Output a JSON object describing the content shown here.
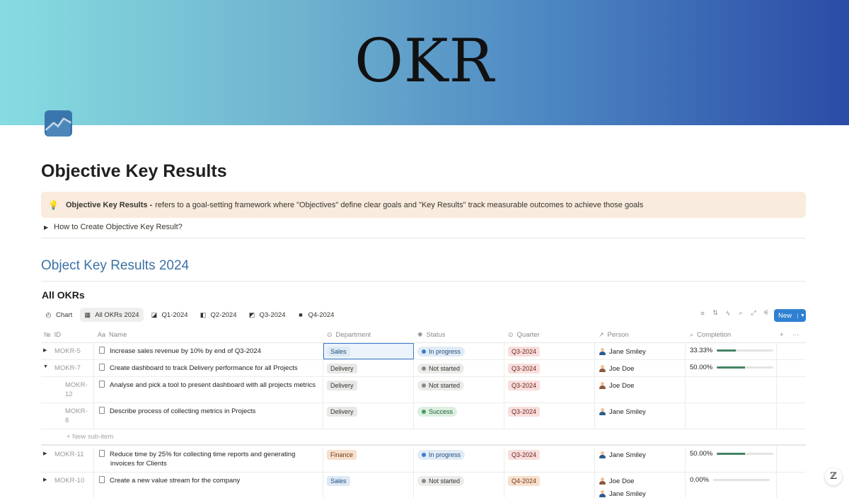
{
  "cover": {
    "title": "OKR"
  },
  "page": {
    "title": "Objective Key Results"
  },
  "callout": {
    "icon": "💡",
    "bold": "Objective Key Results -",
    "text": "refers to a goal-setting framework where \"Objectives\" define clear goals and \"Key Results\" track measurable outcomes to achieve those goals"
  },
  "toggle": {
    "label": "How to Create Objective Key Result?"
  },
  "section": {
    "heading": "Object Key Results 2024"
  },
  "database": {
    "title": "All OKRs",
    "views": [
      {
        "label": "Chart",
        "icon": "◴"
      },
      {
        "label": "All OKRs 2024",
        "icon": "▦"
      },
      {
        "label": "Q1-2024",
        "icon": "◪"
      },
      {
        "label": "Q2-2024",
        "icon": "◧"
      },
      {
        "label": "Q3-2024",
        "icon": "◩"
      },
      {
        "label": "Q4-2024",
        "icon": "■"
      }
    ],
    "new_label": "New",
    "columns": {
      "id": "ID",
      "id_icon": "№",
      "name": "Name",
      "name_icon": "Aa",
      "department": "Department",
      "status": "Status",
      "quarter": "Quarter",
      "person": "Person",
      "completion": "Completion"
    },
    "new_sub_item": "+ New sub-item",
    "rows": [
      {
        "id": "MOKR-5",
        "name": "Increase sales revenue by 10% by end of Q3-2024",
        "department": "Sales",
        "status": "In progress",
        "quarter": "Q3-2024",
        "person1": "Jane Smiley",
        "completion": "33.33%",
        "completion_value": 0.3333
      },
      {
        "id": "MOKR-7",
        "name": "Create dashboard to track Delivery performance for all Projects",
        "department": "Delivery",
        "status": "Not started",
        "quarter": "Q3-2024",
        "person1": "Joe Doe",
        "completion": "50.00%",
        "completion_value": 0.5
      },
      {
        "id_a": "MOKR-",
        "id_b": "12",
        "name": "Analyse and pick a tool to present dashboard with all projects metrics",
        "department": "Delivery",
        "status": "Not started",
        "quarter": "Q3-2024",
        "person1": "Joe Doe"
      },
      {
        "id_a": "MOKR-",
        "id_b": "8",
        "name": "Describe process of collecting metrics in Projects",
        "department": "Delivery",
        "status": "Success",
        "quarter": "Q3-2024",
        "person1": "Jane Smiley"
      },
      {
        "id": "MOKR-11",
        "name_a": "Reduce time by 25% for collecting time reports and generating",
        "name_b": "invoices for Clients",
        "department": "Finance",
        "status": "In progress",
        "quarter": "Q3-2024",
        "person1": "Jane Smiley",
        "completion": "50.00%",
        "completion_value": 0.5
      },
      {
        "id": "MOKR-10",
        "name": "Create a new value stream for the company",
        "department": "Sales",
        "status": "Not started",
        "quarter": "Q4-2024",
        "person1": "Joe Doe",
        "person2": "Jane Smiley",
        "completion": "0.00%",
        "completion_value": 0
      }
    ]
  }
}
